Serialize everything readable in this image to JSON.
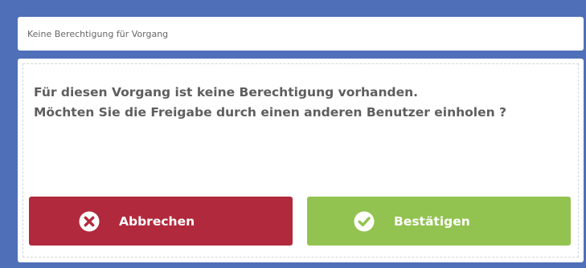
{
  "dialog": {
    "title": "Keine Berechtigung für Vorgang",
    "message_line1": "Für diesen Vorgang ist keine Berechtigung vorhanden.",
    "message_line2": "Möchten Sie die Freigabe durch einen anderen Benutzer einholen ?",
    "cancel_button": {
      "label": "Abbrechen",
      "icon": "close-circle-icon",
      "color": "#b1293c"
    },
    "confirm_button": {
      "label": "Bestätigen",
      "icon": "check-circle-icon",
      "color": "#92c350"
    }
  },
  "colors": {
    "background": "#4f6fb8",
    "panel": "#ffffff",
    "text": "#5e5e5e"
  }
}
